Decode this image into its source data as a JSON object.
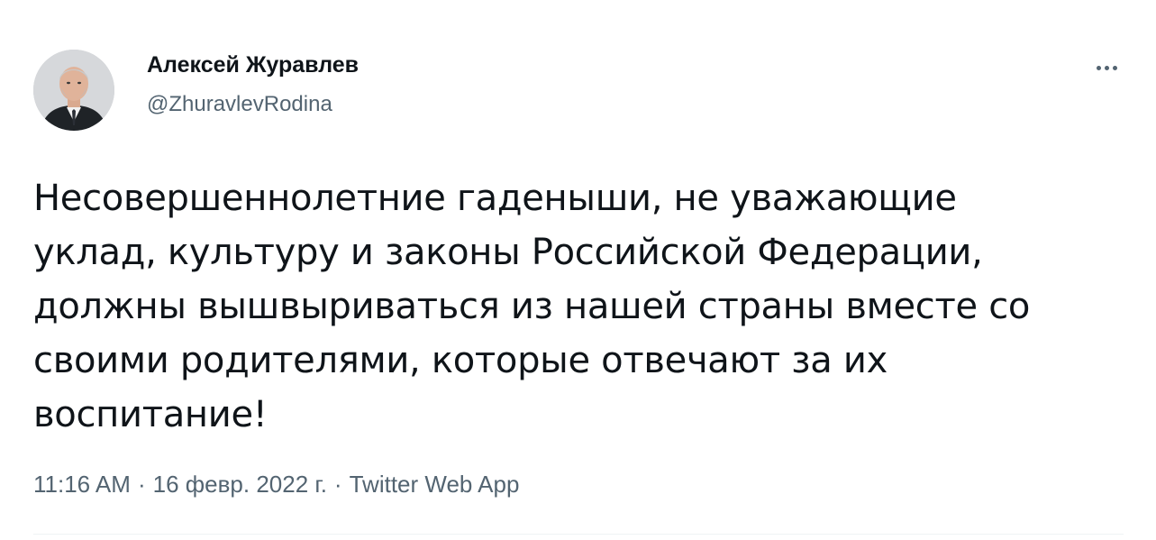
{
  "author": {
    "name": "Алексей Журавлев",
    "handle": "@ZhuravlevRodina",
    "avatar_icon": "user-avatar-photo"
  },
  "tweet": {
    "lines": [
      "Несовершеннолетние гаденыши, не уважающие",
      "уклад, культуру и законы Российской Федерации,",
      "должны вышвыриваться из нашей страны вместе со",
      "своими родителями, которые отвечают за их",
      "воспитание!"
    ]
  },
  "meta": {
    "time": "11:16 AM",
    "separator": "·",
    "date": "16 февр. 2022 г.",
    "source": "Twitter Web App"
  },
  "icons": {
    "more": "more-options-icon"
  },
  "colors": {
    "text_primary": "#0f1419",
    "text_secondary": "#536471",
    "background": "#ffffff"
  }
}
